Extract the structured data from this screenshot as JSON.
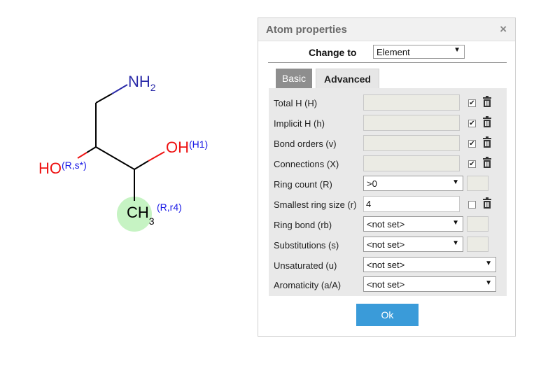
{
  "molecule": {
    "nh_text": "NH",
    "nh_sub": "2",
    "oh_text": "OH",
    "oh_qual": "(H1)",
    "ho_text": "HO",
    "ho_qual": "(R,s*)",
    "ch_text": "CH",
    "ch_sub": "3",
    "ch_qual": "(R,r4)",
    "highlight_color": "#c6f3c3"
  },
  "dialog": {
    "title": "Atom properties",
    "close_glyph": "×",
    "change_to_label": "Change to",
    "change_to_value": "Element",
    "tabs": [
      "Basic",
      "Advanced"
    ],
    "rows": [
      {
        "label": "Total H (H)",
        "value": "",
        "checked": true
      },
      {
        "label": "Implicit H (h)",
        "value": "",
        "checked": true
      },
      {
        "label": "Bond orders (v)",
        "value": "",
        "checked": true
      },
      {
        "label": "Connections (X)",
        "value": "",
        "checked": true
      },
      {
        "label": "Ring count (R)",
        "value": ">0"
      },
      {
        "label": "Smallest ring size (r)",
        "value": "4",
        "checked": false
      },
      {
        "label": "Ring bond (rb)",
        "value": "<not set>"
      },
      {
        "label": "Substitutions (s)",
        "value": "<not set>"
      },
      {
        "label": "Unsaturated (u)",
        "value": "<not set>"
      },
      {
        "label": "Aromaticity (a/A)",
        "value": "<not set>"
      }
    ],
    "ok_label": "Ok"
  },
  "colors": {
    "accent": "#3a9bd9",
    "nitrogen": "#2a2aa8",
    "oxygen": "#ee1111",
    "qualifier": "#1a1ae6"
  }
}
